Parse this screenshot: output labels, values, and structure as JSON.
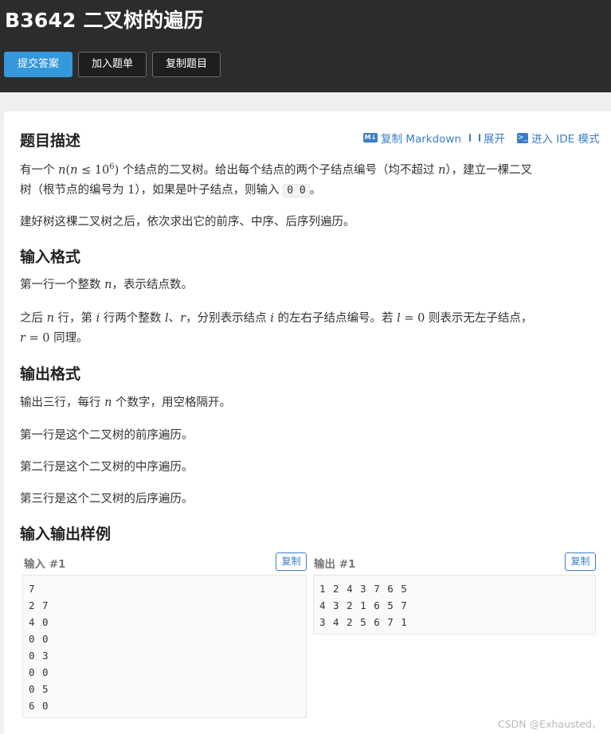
{
  "header": {
    "title": "B3642 二叉树的遍历",
    "buttons": {
      "submit": "提交答案",
      "add_to_list": "加入题单",
      "copy_problem": "复制题目"
    }
  },
  "toolbar": {
    "copy_markdown": "复制 Markdown",
    "expand": "展开",
    "ide_mode": "进入 IDE 模式",
    "md_badge": "M↓",
    "ide_badge": ">_"
  },
  "sections": {
    "description": {
      "title": "题目描述",
      "p1": {
        "t1": "有一个 ",
        "n": "n",
        "lp": "(",
        "n2": "n",
        "le": " ≤ 10",
        "exp": "6",
        "rp": ")",
        "t2": " 个结点的二叉树。给出每个结点的两个子结点编号（均不超过 ",
        "n3": "n",
        "t3": "），建立一棵二叉",
        "t4": "树（根节点的编号为 ",
        "one": "1",
        "t5": "），如果是叶子结点，则输入 ",
        "code": "0 0",
        "t6": "。"
      },
      "p2": "建好树这棵二叉树之后，依次求出它的前序、中序、后序列遍历。"
    },
    "input_format": {
      "title": "输入格式",
      "p1": {
        "t1": "第一行一个整数 ",
        "n": "n",
        "t2": "，表示结点数。"
      },
      "p2": {
        "t1": "之后 ",
        "n": "n",
        "t2": " 行，第 ",
        "i": "i",
        "t3": " 行两个整数 ",
        "l": "l",
        "t4": "、",
        "r": "r",
        "t5": "，分别表示结点 ",
        "i2": "i",
        "t6": " 的左右子结点编号。若 ",
        "l0": "l",
        "eq0": " = 0",
        "t7": " 则表示无左子结点，",
        "r0": "r",
        "eq1": " = 0",
        "t8": " 同理。"
      }
    },
    "output_format": {
      "title": "输出格式",
      "p1": {
        "t1": "输出三行，每行 ",
        "n": "n",
        "t2": " 个数字，用空格隔开。"
      },
      "lines": [
        "第一行是这个二叉树的前序遍历。",
        "第二行是这个二叉树的中序遍历。",
        "第三行是这个二叉树的后序遍历。"
      ]
    },
    "samples": {
      "title": "输入输出样例",
      "input": {
        "label": "输入 #1",
        "copy": "复制",
        "lines": [
          "7",
          "2 7",
          "4 0",
          "0 0",
          "0 3",
          "0 0",
          "0 5",
          "6 0"
        ]
      },
      "output": {
        "label": "输出 #1",
        "copy": "复制",
        "lines": [
          "1 2 4 3 7 6 5",
          "4 3 2 1 6 5 7",
          "3 4 2 5 6 7 1"
        ]
      }
    }
  },
  "watermark": "CSDN @Exhausted、"
}
